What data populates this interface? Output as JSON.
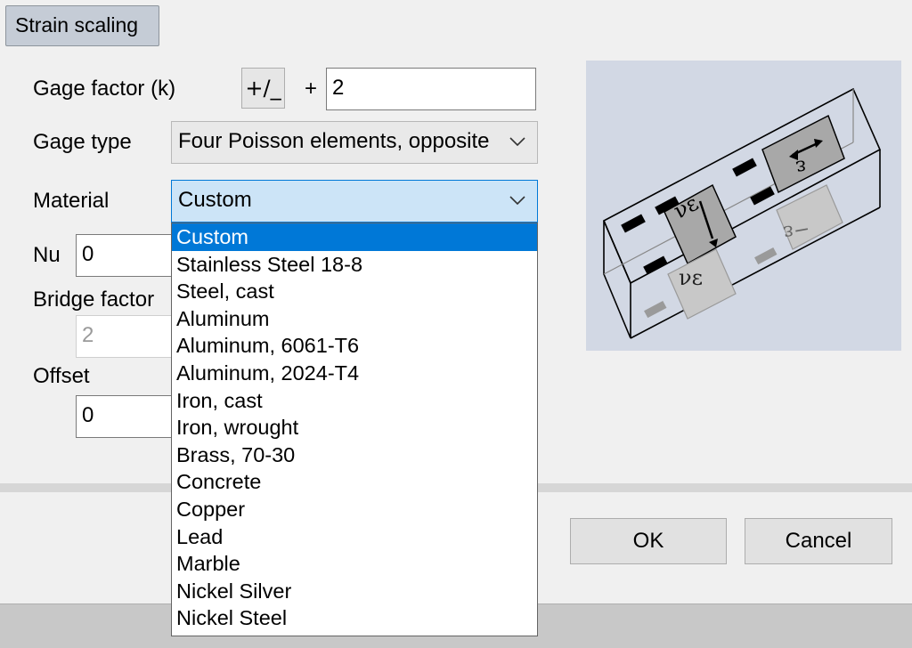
{
  "tab": {
    "label": "Strain scaling"
  },
  "gage_factor": {
    "label": "Gage factor (k)",
    "sign_button": "+/_",
    "sign": "+",
    "value": "2"
  },
  "gage_type": {
    "label": "Gage type",
    "value": "Four Poisson elements, opposite"
  },
  "material": {
    "label": "Material",
    "value": "Custom",
    "options": [
      "Custom",
      "Stainless Steel 18-8",
      "Steel, cast",
      "Aluminum",
      "Aluminum, 6061-T6",
      "Aluminum, 2024-T4",
      "Iron, cast",
      "Iron, wrought",
      "Brass, 70-30",
      "Concrete",
      "Copper",
      "Lead",
      "Marble",
      "Nickel Silver",
      "Nickel Steel"
    ],
    "selected_index": 0
  },
  "nu": {
    "label": "Nu",
    "value": "0"
  },
  "bridge_factor": {
    "label": "Bridge factor",
    "value": "2"
  },
  "offset": {
    "label": "Offset",
    "value": "0"
  },
  "diagram": {
    "labels": [
      "ε",
      "νε",
      "νε",
      "−ε"
    ]
  },
  "buttons": {
    "ok": "OK",
    "cancel": "Cancel"
  },
  "colors": {
    "selection": "#0078d7",
    "open_combo": "#cce4f7",
    "diagram_bg": "#d2d8e4"
  }
}
